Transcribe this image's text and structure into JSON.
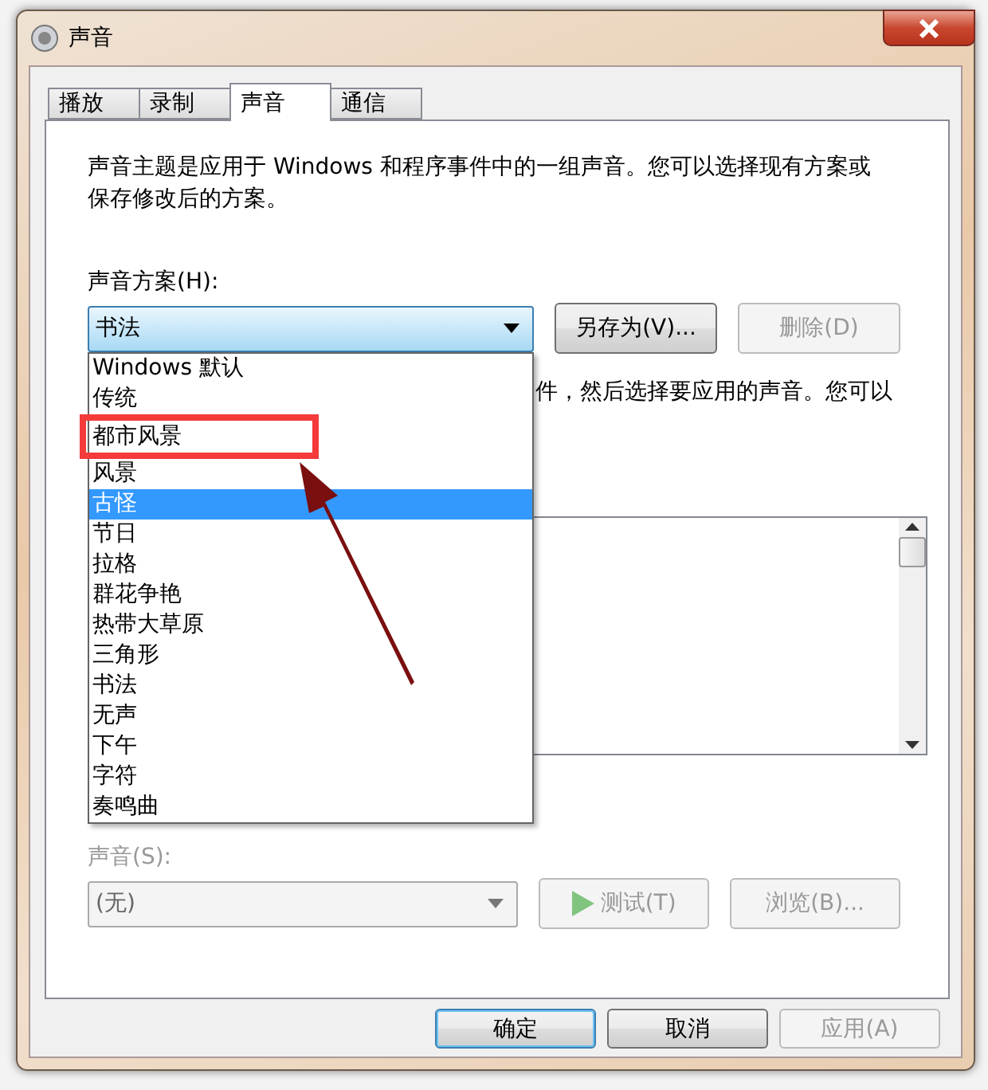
{
  "window": {
    "title": "声音"
  },
  "tabs": [
    {
      "label": "播放",
      "selected": false
    },
    {
      "label": "录制",
      "selected": false
    },
    {
      "label": "声音",
      "selected": true
    },
    {
      "label": "通信",
      "selected": false
    }
  ],
  "description": "声音主题是应用于 Windows 和程序事件中的一组声音。您可以选择现有方案或保存修改后的方案。",
  "scheme_label": "声音方案(H):",
  "scheme_combo": {
    "value": "书法",
    "expanded": true
  },
  "scheme_buttons": [
    {
      "label": "另存为(V)...",
      "disabled": false
    },
    {
      "label": "删除(D)",
      "disabled": true
    }
  ],
  "scheme_options": [
    {
      "label": "Windows 默认",
      "selected": false,
      "annotated": false
    },
    {
      "label": "传统",
      "selected": false,
      "annotated": false
    },
    {
      "label": "都市风景",
      "selected": false,
      "annotated": true
    },
    {
      "label": "风景",
      "selected": false,
      "annotated": false
    },
    {
      "label": "古怪",
      "selected": true,
      "annotated": false
    },
    {
      "label": "节日",
      "selected": false,
      "annotated": false
    },
    {
      "label": "拉格",
      "selected": false,
      "annotated": false
    },
    {
      "label": "群花争艳",
      "selected": false,
      "annotated": false
    },
    {
      "label": "热带大草原",
      "selected": false,
      "annotated": false
    },
    {
      "label": "三角形",
      "selected": false,
      "annotated": false
    },
    {
      "label": "书法",
      "selected": false,
      "annotated": false
    },
    {
      "label": "无声",
      "selected": false,
      "annotated": false
    },
    {
      "label": "下午",
      "selected": false,
      "annotated": false
    },
    {
      "label": "字符",
      "selected": false,
      "annotated": false
    },
    {
      "label": "奏鸣曲",
      "selected": false,
      "annotated": false
    }
  ],
  "partial_text": "件，然后选择要应用的声音。您可以",
  "sound_label": "声音(S):",
  "sound_combo": {
    "value": "(无)",
    "disabled": true
  },
  "sound_buttons": [
    {
      "label": "测试(T)",
      "kind": "play",
      "disabled": true
    },
    {
      "label": "浏览(B)...",
      "kind": "plain",
      "disabled": true
    }
  ],
  "dialog_buttons": [
    {
      "label": "确定",
      "disabled": false,
      "default": true
    },
    {
      "label": "取消",
      "disabled": false,
      "default": false
    },
    {
      "label": "应用(A)",
      "disabled": true,
      "default": false
    }
  ]
}
